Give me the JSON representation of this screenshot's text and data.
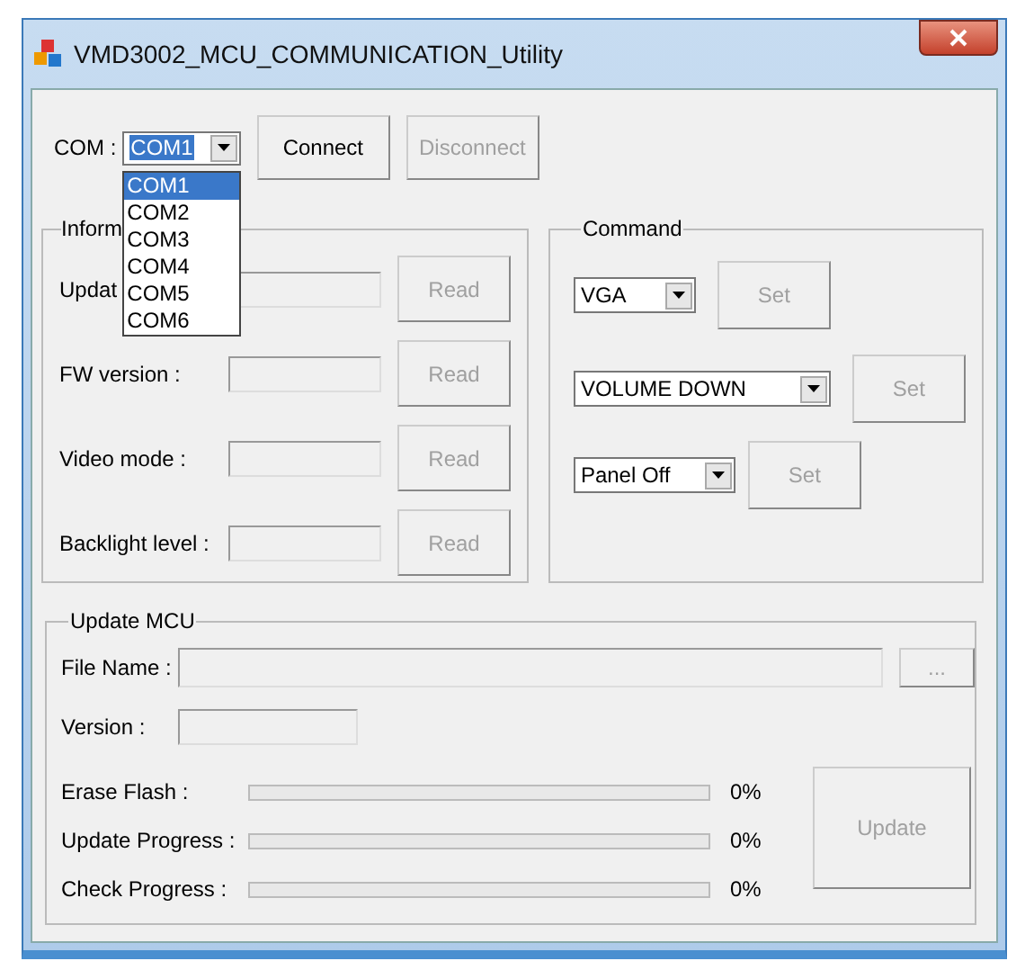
{
  "window": {
    "title": "VMD3002_MCU_COMMUNICATION_Utility"
  },
  "com": {
    "label": "COM :",
    "value": "COM1",
    "options": [
      {
        "label": "COM1",
        "selected": true
      },
      {
        "label": "COM2",
        "selected": false
      },
      {
        "label": "COM3",
        "selected": false
      },
      {
        "label": "COM4",
        "selected": false
      },
      {
        "label": "COM5",
        "selected": false
      },
      {
        "label": "COM6",
        "selected": false
      }
    ],
    "buttons": [
      {
        "label": "Connect",
        "disabled": false
      },
      {
        "label": "Disconnect",
        "disabled": true
      }
    ]
  },
  "information": {
    "title": "Inform",
    "rows": [
      {
        "label": "Updat",
        "button": "Read",
        "disabled": true
      },
      {
        "label": "FW version :",
        "button": "Read",
        "disabled": true
      },
      {
        "label": "Video mode :",
        "button": "Read",
        "disabled": true
      },
      {
        "label": "Backlight level :",
        "button": "Read",
        "disabled": true
      }
    ]
  },
  "command": {
    "title": "Command",
    "rows": [
      {
        "value": "VGA",
        "button": "Set",
        "disabled": true
      },
      {
        "value": "VOLUME DOWN",
        "button": "Set",
        "disabled": true
      },
      {
        "value": "Panel Off",
        "button": "Set",
        "disabled": true
      }
    ]
  },
  "update_mcu": {
    "title": "Update MCU",
    "file_name_label": "File Name :",
    "browse_button": {
      "label": "...",
      "disabled": true
    },
    "version_label": "Version :",
    "progress": [
      {
        "label": "Erase Flash :",
        "level": 0,
        "reading": "0%"
      },
      {
        "label": "Update Progress :",
        "level": 0,
        "reading": "0%"
      },
      {
        "label": "Check Progress :",
        "level": 0,
        "reading": "0%"
      }
    ],
    "update_button": {
      "label": "Update",
      "disabled": true
    }
  }
}
